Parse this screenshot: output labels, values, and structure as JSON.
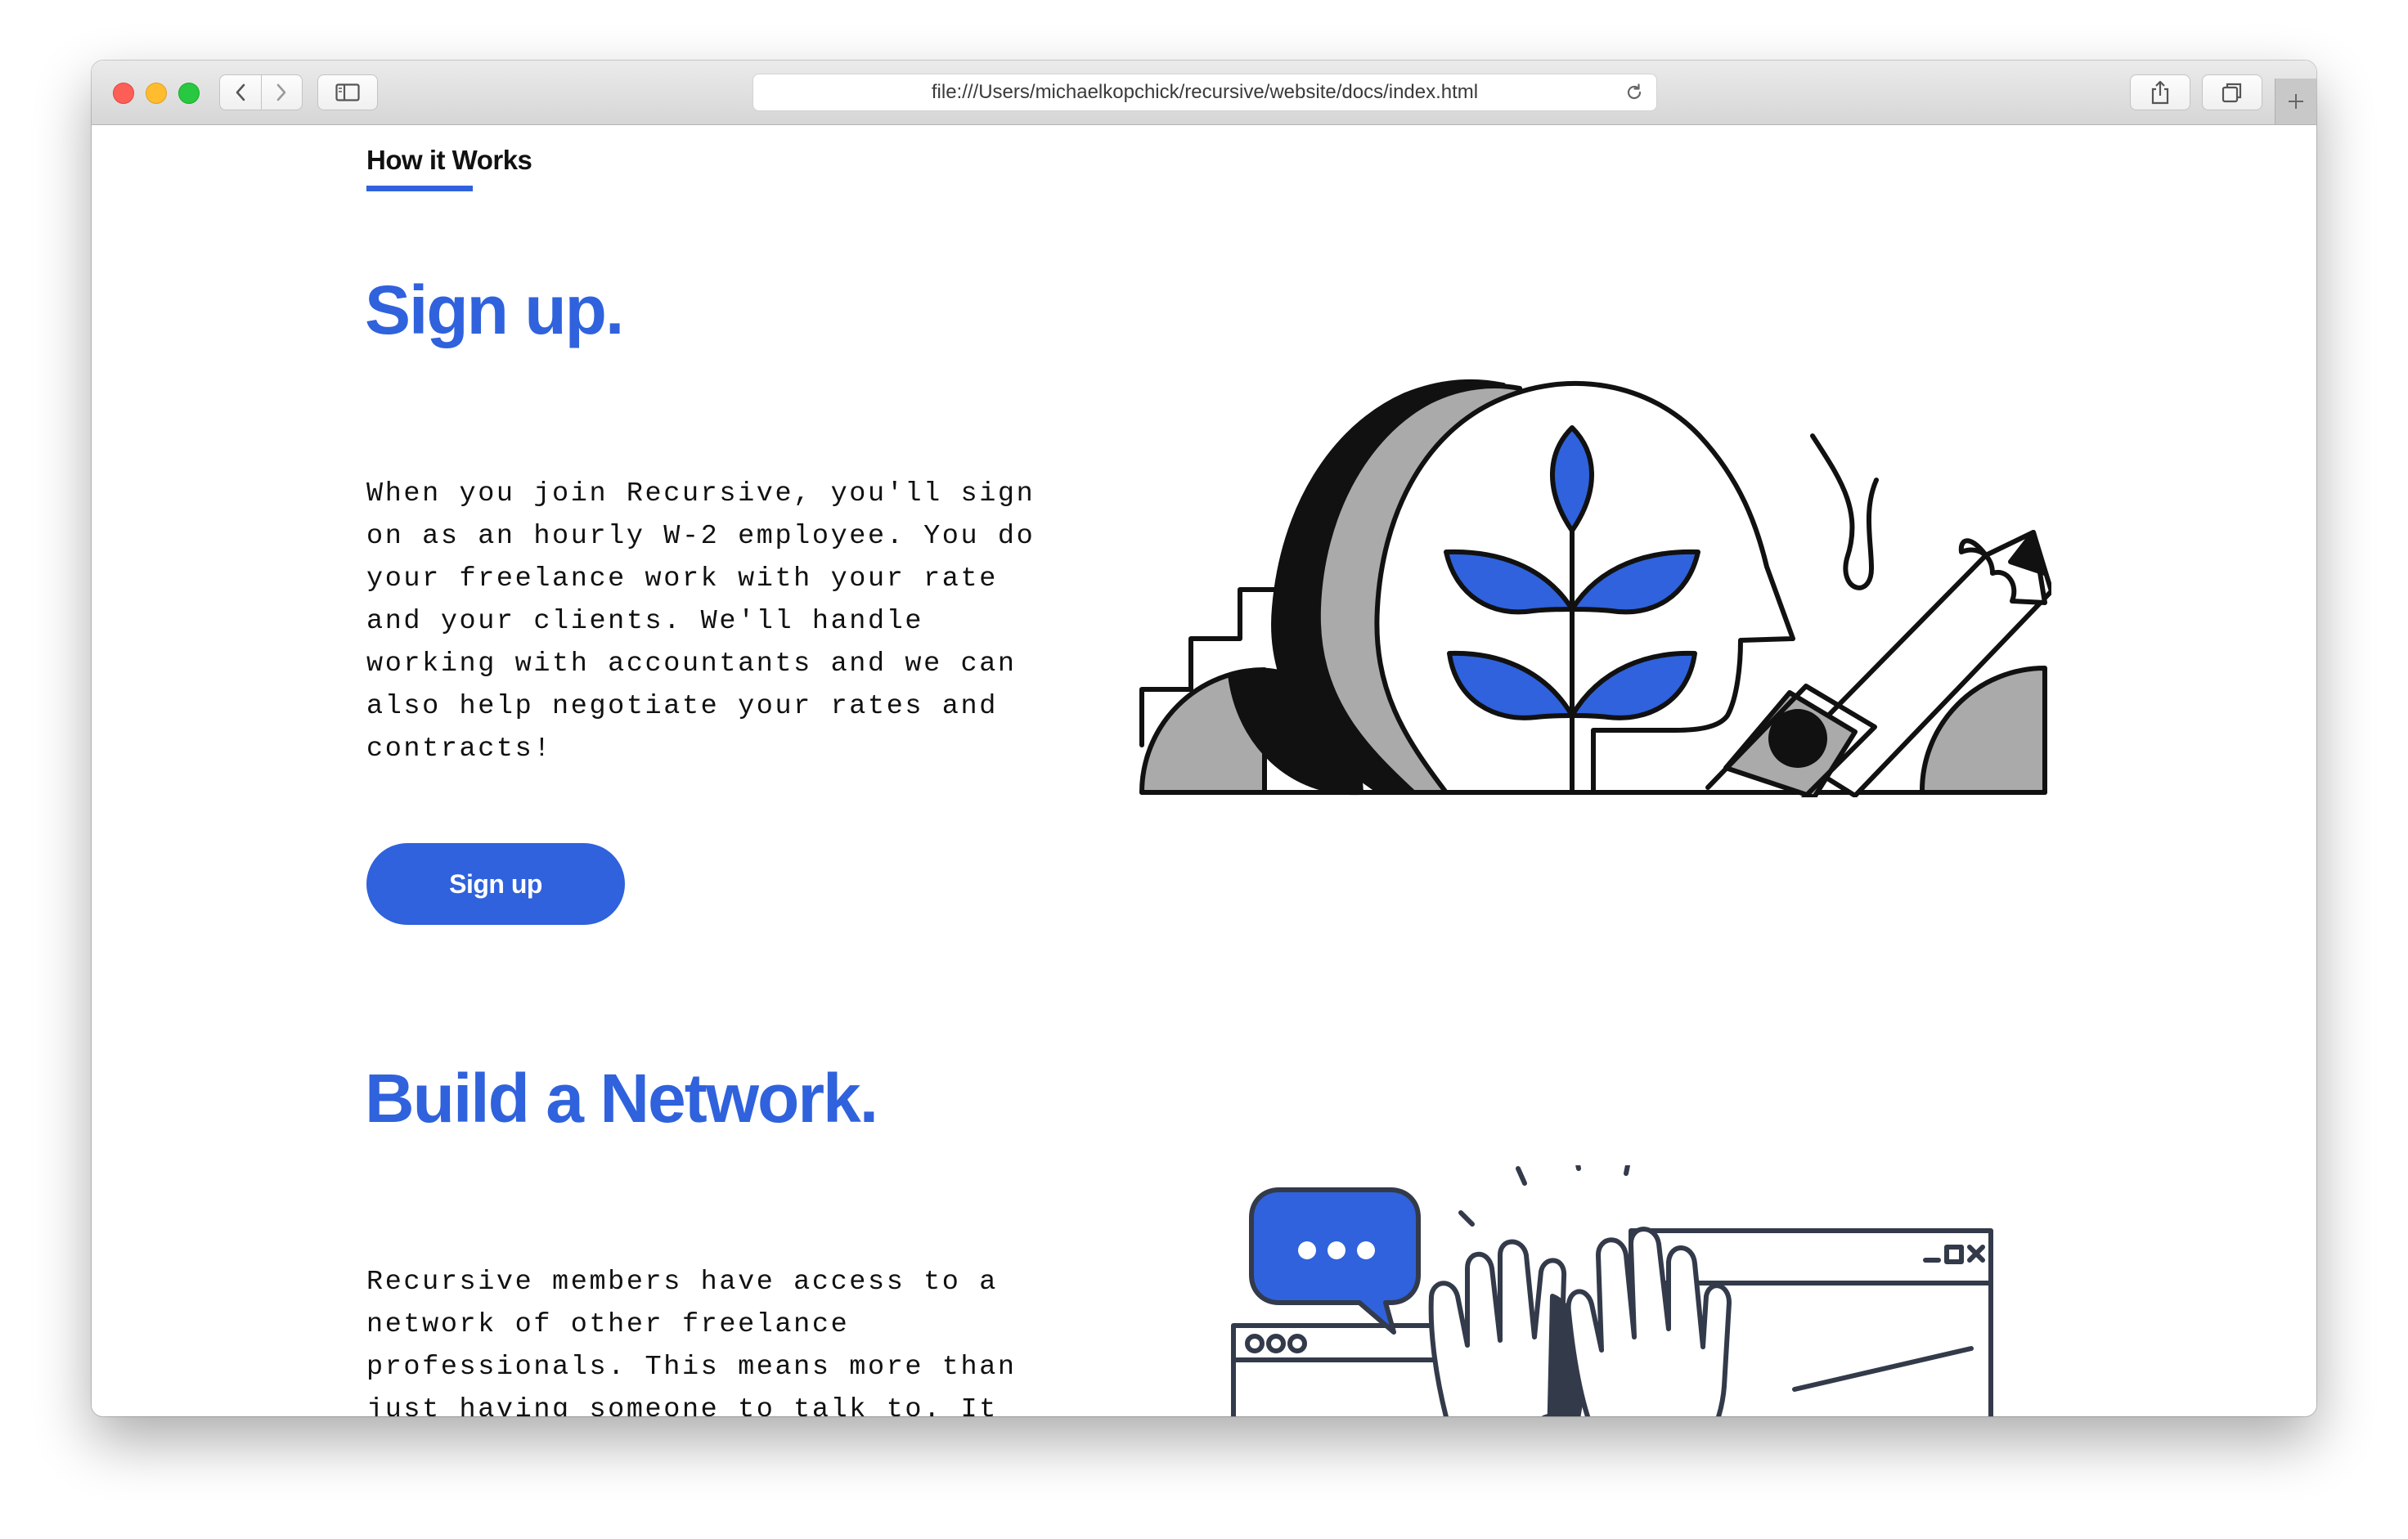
{
  "browser": {
    "url": "file:///Users/michaelkopchick/recursive/website/docs/index.html",
    "icons": {
      "close": "red-traffic-light",
      "minimize": "yellow-traffic-light",
      "maximize": "green-traffic-light",
      "back": "chevron-left-icon",
      "forward": "chevron-right-icon",
      "sidebar": "sidebar-icon",
      "reload": "reload-icon",
      "share": "share-icon",
      "tabs": "tabs-icon",
      "new_tab": "plus-icon"
    }
  },
  "page": {
    "section_label": "How it Works",
    "accent_color": "#2f62dc",
    "sections": [
      {
        "heading": "Sign up.",
        "body": "When you join Recursive, you'll sign\non as an hourly W-2 employee. You do\nyour freelance work with your rate\nand your clients. We'll handle\nworking with accountants and we can\nalso help negotiate your rates and\ncontracts!",
        "button_label": "Sign up",
        "illustration": "head-with-plant-and-pencil-illustration"
      },
      {
        "heading": "Build a Network.",
        "body": "Recursive members have access to a\nnetwork of other freelance\nprofessionals. This means more than\njust having someone to talk to. It\nmeans more work opportunities. It\nmeans career advice and advancement.",
        "illustration": "high-five-chat-window-illustration"
      }
    ]
  }
}
